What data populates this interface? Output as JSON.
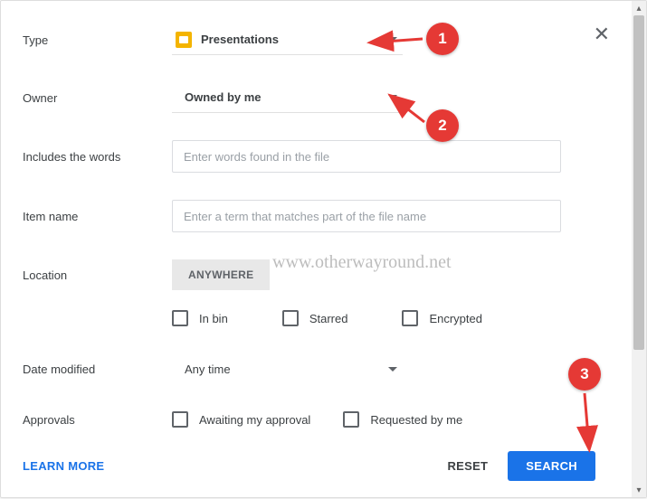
{
  "labels": {
    "type": "Type",
    "owner": "Owner",
    "includes": "Includes the words",
    "item_name": "Item name",
    "location": "Location",
    "date_modified": "Date modified",
    "approvals": "Approvals"
  },
  "type_dropdown": {
    "value": "Presentations"
  },
  "owner_dropdown": {
    "value": "Owned by me"
  },
  "includes_input": {
    "placeholder": "Enter words found in the file",
    "value": ""
  },
  "item_name_input": {
    "placeholder": "Enter a term that matches part of the file name",
    "value": ""
  },
  "location_chip": "ANYWHERE",
  "checkboxes": {
    "in_bin": "In bin",
    "starred": "Starred",
    "encrypted": "Encrypted"
  },
  "date_dropdown": {
    "value": "Any time"
  },
  "approvals_checks": {
    "awaiting": "Awaiting my approval",
    "requested": "Requested by me"
  },
  "footer": {
    "learn_more": "LEARN MORE",
    "reset": "RESET",
    "search": "SEARCH"
  },
  "watermark": "www.otherwayround.net",
  "annotations": {
    "n1": "1",
    "n2": "2",
    "n3": "3"
  }
}
